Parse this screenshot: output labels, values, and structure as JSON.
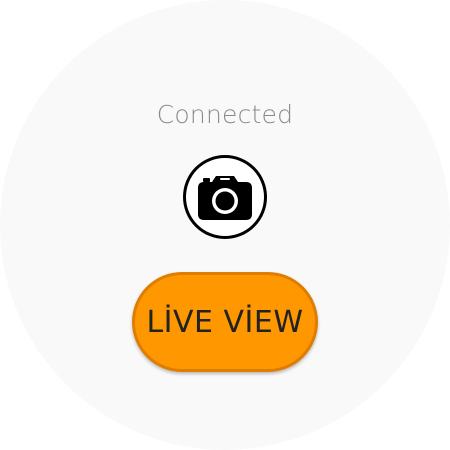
{
  "status": {
    "text": "Connected"
  },
  "camera": {
    "icon": "camera-icon"
  },
  "live_view": {
    "label": "LİVE VİEW",
    "color": "#ff9800",
    "border_color": "#e07d00"
  }
}
